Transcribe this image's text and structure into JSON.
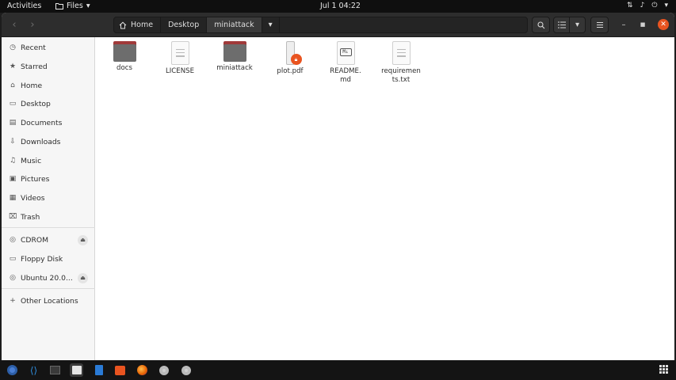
{
  "topbar": {
    "activities": "Activities",
    "app_menu": "Files",
    "clock": "Jul 1  04:22",
    "icons": [
      "network-icon",
      "volume-icon",
      "power-icon",
      "chevron-down-icon"
    ]
  },
  "headerbar": {
    "back_icon": "chevron-left-icon",
    "forward_icon": "chevron-right-icon",
    "path": {
      "home": "Home",
      "desktop": "Desktop",
      "current": "miniattack"
    },
    "buttons": [
      "search-icon",
      "list-view-icon",
      "view-options-icon",
      "hamburger-menu-icon"
    ],
    "window_controls": [
      "minimize-icon",
      "maximize-icon",
      "close-icon"
    ]
  },
  "sidebar": {
    "places": [
      {
        "label": "Recent",
        "icon": "clock-icon"
      },
      {
        "label": "Starred",
        "icon": "star-icon"
      },
      {
        "label": "Home",
        "icon": "home-icon"
      },
      {
        "label": "Desktop",
        "icon": "desktop-icon"
      },
      {
        "label": "Documents",
        "icon": "document-icon"
      },
      {
        "label": "Downloads",
        "icon": "download-icon"
      },
      {
        "label": "Music",
        "icon": "music-icon"
      },
      {
        "label": "Pictures",
        "icon": "pictures-icon"
      },
      {
        "label": "Videos",
        "icon": "videos-icon"
      },
      {
        "label": "Trash",
        "icon": "trash-icon"
      }
    ],
    "devices": [
      {
        "label": "CDROM",
        "icon": "disc-icon",
        "ejectable": true
      },
      {
        "label": "Floppy Disk",
        "icon": "drive-icon",
        "ejectable": false
      },
      {
        "label": "Ubuntu 20.0...",
        "icon": "disc-icon",
        "ejectable": true
      }
    ],
    "other": {
      "label": "Other Locations",
      "icon": "plus-icon"
    }
  },
  "files": [
    {
      "name": "docs",
      "kind": "folder"
    },
    {
      "name": "LICENSE",
      "kind": "text"
    },
    {
      "name": "miniattack",
      "kind": "folder"
    },
    {
      "name": "plot.pdf",
      "kind": "pdf-locked"
    },
    {
      "name": "README.\nmd",
      "kind": "markdown"
    },
    {
      "name": "requiremen\nts.txt",
      "kind": "text"
    }
  ],
  "dock": {
    "apps": [
      "chromium-icon",
      "vscode-icon",
      "terminal-icon",
      "files-icon",
      "writer-icon",
      "software-icon",
      "firefox-icon",
      "disc-icon",
      "disc-icon"
    ],
    "active_index": 3
  },
  "colors": {
    "accent": "#e95420",
    "folder_tab": "#a03a3a",
    "folder_body": "#6d6d6d",
    "headerbar": "#2d2d2d"
  }
}
